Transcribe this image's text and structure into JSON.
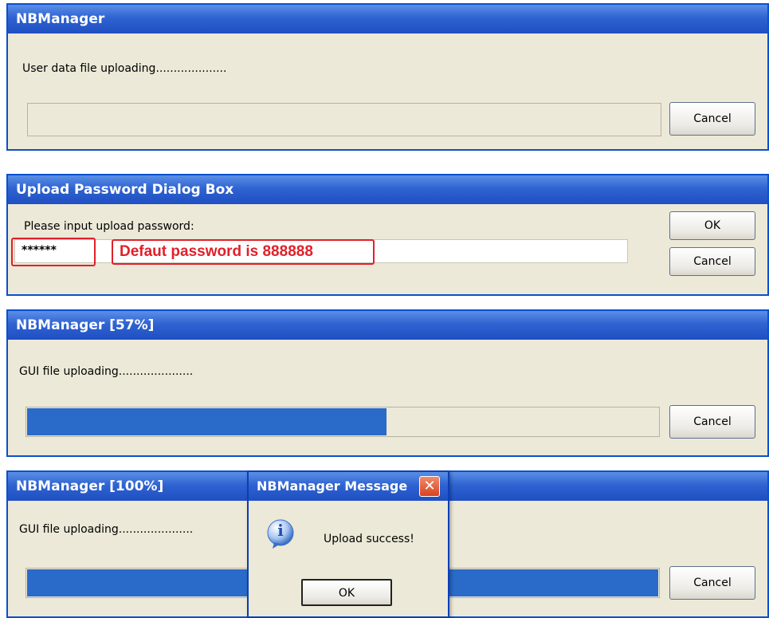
{
  "window1": {
    "title": "NBManager",
    "status": "User data file uploading....................",
    "cancel_label": "Cancel"
  },
  "window2": {
    "title": "Upload Password Dialog Box",
    "prompt": "Please input upload password:",
    "password_value": "******",
    "annotation": "Defaut password is 888888",
    "ok_label": "OK",
    "cancel_label": "Cancel"
  },
  "window3": {
    "title": "NBManager [57%]",
    "status": "GUI file uploading.....................",
    "progress_percent": 57,
    "cancel_label": "Cancel"
  },
  "window4": {
    "title": "NBManager [100%]",
    "status": "GUI file uploading.....................",
    "progress_percent": 100,
    "cancel_label": "Cancel"
  },
  "message_box": {
    "title": "NBManager Message",
    "close_glyph": "✕",
    "info_glyph": "i",
    "message": "Upload success!",
    "ok_label": "OK"
  },
  "colors": {
    "title_bar": "#2f63d1",
    "progress_fill": "#2a6ac9",
    "annotation_red": "#e0202a"
  },
  "icons": [
    "info-icon",
    "close-icon"
  ]
}
